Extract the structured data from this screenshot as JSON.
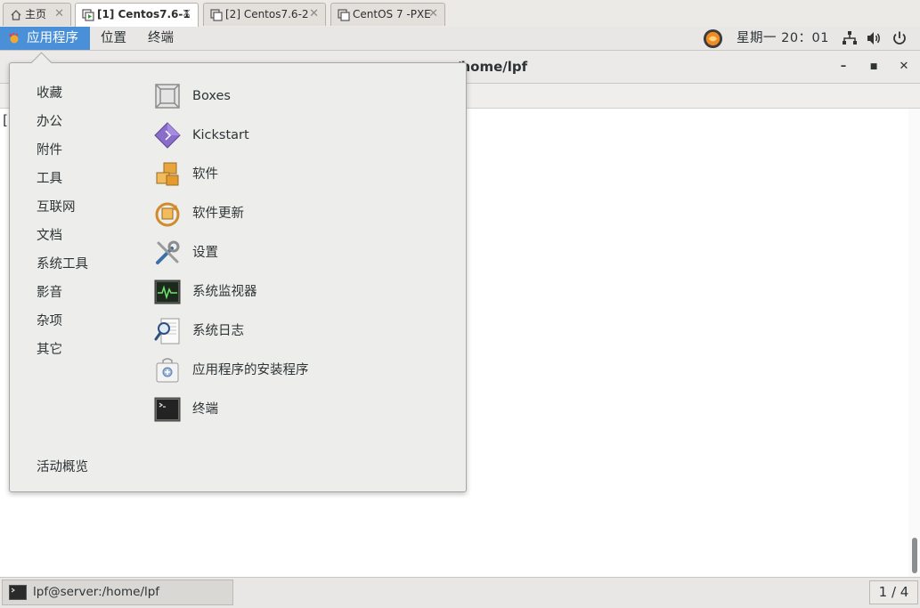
{
  "vm_tabs": [
    {
      "label": "主页",
      "icon": "home-icon",
      "active": false
    },
    {
      "label": "[1] Centos7.6-1",
      "icon": "vm-running-icon",
      "active": true
    },
    {
      "label": "[2] Centos7.6-2",
      "icon": "vm-icon",
      "active": false
    },
    {
      "label": "CentOS 7 -PXE",
      "icon": "vm-icon",
      "active": false
    }
  ],
  "topbar": {
    "applications": "应用程序",
    "places": "位置",
    "terminal": "终端",
    "clock": "星期一 20：01",
    "tray_icons": [
      "user-avatar-icon",
      "network-icon",
      "volume-icon",
      "power-icon"
    ]
  },
  "terminal_window": {
    "title_fragment": "/home/lpf",
    "cursor_fragment": "["
  },
  "apps_menu": {
    "categories": [
      "收藏",
      "办公",
      "附件",
      "工具",
      "互联网",
      "文档",
      "系统工具",
      "影音",
      "杂项",
      "其它"
    ],
    "activities": "活动概览",
    "apps": [
      {
        "label": "Boxes",
        "icon": "boxes-icon"
      },
      {
        "label": "Kickstart",
        "icon": "kickstart-icon"
      },
      {
        "label": "软件",
        "icon": "software-icon"
      },
      {
        "label": "软件更新",
        "icon": "software-update-icon"
      },
      {
        "label": "设置",
        "icon": "settings-icon"
      },
      {
        "label": "系统监视器",
        "icon": "system-monitor-icon"
      },
      {
        "label": "系统日志",
        "icon": "system-log-icon"
      },
      {
        "label": "应用程序的安装程序",
        "icon": "app-installer-icon"
      },
      {
        "label": "终端",
        "icon": "terminal-icon"
      }
    ]
  },
  "taskbar": {
    "window_label": "lpf@server:/home/lpf",
    "pager": "1 / 4"
  },
  "colors": {
    "accent": "#4a90d9",
    "menu_bg": "#ededeb",
    "topbar_bg": "#e8e7e5"
  }
}
